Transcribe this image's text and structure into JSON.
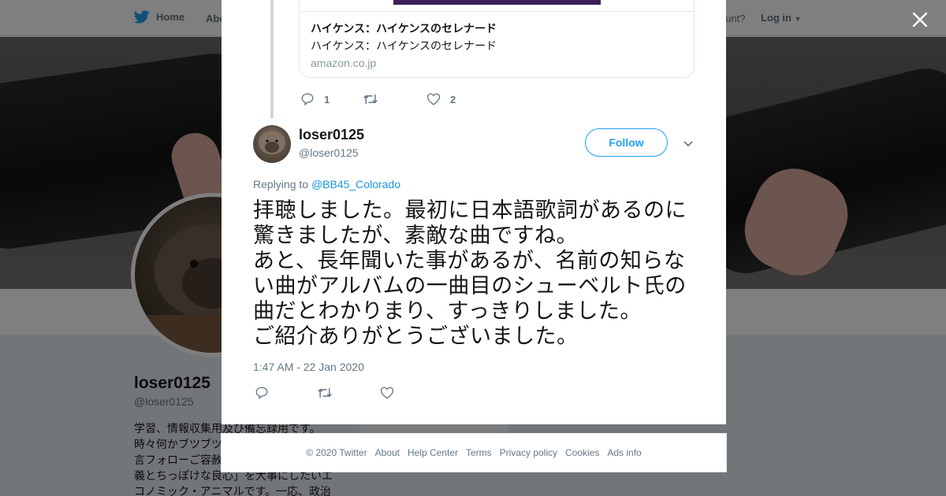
{
  "topbar": {
    "home_label": "Home",
    "about_label": "Abo",
    "account_question": "ccount?",
    "login_label": "Log in"
  },
  "profile": {
    "name": "loser0125",
    "handle": "@loser0125",
    "bio_lines": [
      "学習、情報収集用及び備忘録用です。",
      "時々何かブツブツ",
      "言フォローご容赦",
      "義とちっぽけな良心」を大事にしたいエ",
      "コノミック・アニマルです。一応、政治"
    ]
  },
  "parent_tweet": {
    "card": {
      "title": "ハイケンス：ハイケンスのセレナード",
      "description": "ハイケンス：ハイケンスのセレナード",
      "domain": "amazon.co.jp"
    },
    "reply_count": "1",
    "retweet_count": "",
    "like_count": "2"
  },
  "tweet": {
    "author_name": "loser0125",
    "author_handle": "@loser0125",
    "follow_label": "Follow",
    "replying_prefix": "Replying to ",
    "replying_to": "@BB45_Colorado",
    "text_lines": [
      "拝聴しました。最初に日本語歌詞があるのに",
      "驚きましたが、素敵な曲ですね。",
      "あと、長年聞いた事があるが、名前の知らな",
      "い曲がアルバムの一曲目のシューベルト氏の",
      "曲だとわかりまり、すっきりしました。",
      "ご紹介ありがとうございました。"
    ],
    "timestamp": "1:47 AM - 22 Jan 2020"
  },
  "footer": {
    "copyright": "© 2020 Twitter",
    "links": [
      "About",
      "Help Center",
      "Terms",
      "Privacy policy",
      "Cookies",
      "Ads info"
    ]
  },
  "colors": {
    "accent": "#1da1f2",
    "link": "#1b95e0",
    "muted": "#657786",
    "overlay": "rgba(0,0,0,0.5)"
  },
  "icons": {
    "brand": "twitter-bird-icon",
    "close": "close-icon",
    "reply": "reply-icon",
    "retweet": "retweet-icon",
    "like": "heart-icon",
    "more": "chevron-down-icon"
  }
}
